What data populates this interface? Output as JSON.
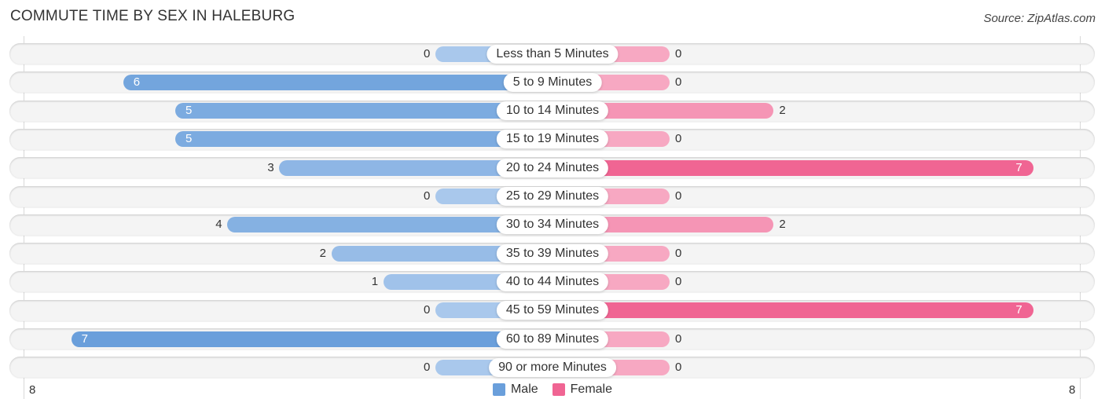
{
  "header": {
    "title": "COMMUTE TIME BY SEX IN HALEBURG",
    "source": "Source: ZipAtlas.com"
  },
  "colors": {
    "male": "#6a9fdb",
    "male_light": "#a9c8ec",
    "female": "#f06593",
    "female_light": "#f7a8c2"
  },
  "chart_data": {
    "type": "bar",
    "orientation": "horizontal-diverging",
    "title": "COMMUTE TIME BY SEX IN HALEBURG",
    "categories": [
      "Less than 5 Minutes",
      "5 to 9 Minutes",
      "10 to 14 Minutes",
      "15 to 19 Minutes",
      "20 to 24 Minutes",
      "25 to 29 Minutes",
      "30 to 34 Minutes",
      "35 to 39 Minutes",
      "40 to 44 Minutes",
      "45 to 59 Minutes",
      "60 to 89 Minutes",
      "90 or more Minutes"
    ],
    "series": [
      {
        "name": "Male",
        "values": [
          0,
          6,
          5,
          5,
          3,
          0,
          4,
          2,
          1,
          0,
          7,
          0
        ]
      },
      {
        "name": "Female",
        "values": [
          0,
          0,
          2,
          0,
          7,
          0,
          2,
          0,
          0,
          7,
          0,
          0
        ]
      }
    ],
    "axis": {
      "left_tick": "8",
      "right_tick": "8",
      "max": 8
    },
    "legend": {
      "position": "bottom-center",
      "entries": [
        "Male",
        "Female"
      ]
    },
    "grid": false
  }
}
